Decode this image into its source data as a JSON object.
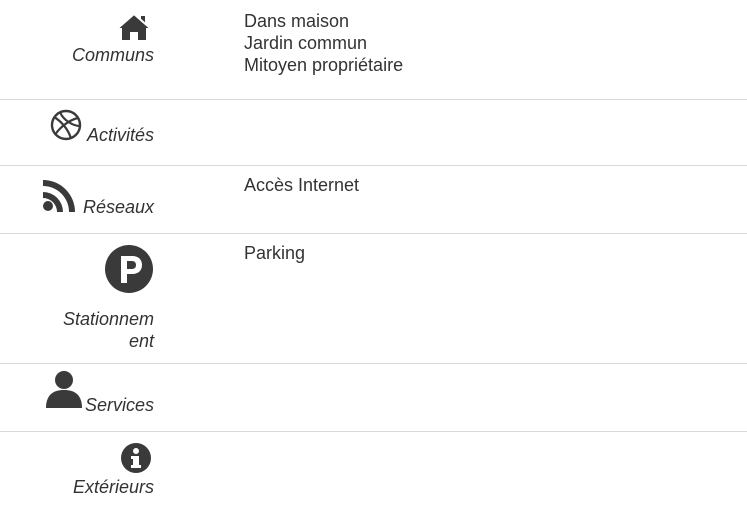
{
  "rows": [
    {
      "icon": "home-icon",
      "label": "Communs",
      "values": [
        "Dans maison",
        "Jardin commun",
        "Mitoyen propriétaire"
      ]
    },
    {
      "icon": "basketball-icon",
      "label": "Activités",
      "values": []
    },
    {
      "icon": "rss-icon",
      "label": "Réseaux",
      "values": [
        "Accès Internet"
      ]
    },
    {
      "icon": "parking-icon",
      "label": "Stationnem ent",
      "label_lines": [
        "Stationnem",
        "ent"
      ],
      "values": [
        "Parking"
      ]
    },
    {
      "icon": "user-icon",
      "label": "Services",
      "values": []
    },
    {
      "icon": "info-icon",
      "label": "Extérieurs",
      "values": []
    }
  ],
  "colors": {
    "text": "#333333",
    "divider": "#d9d9d9",
    "icon": "#3a3a3a"
  }
}
